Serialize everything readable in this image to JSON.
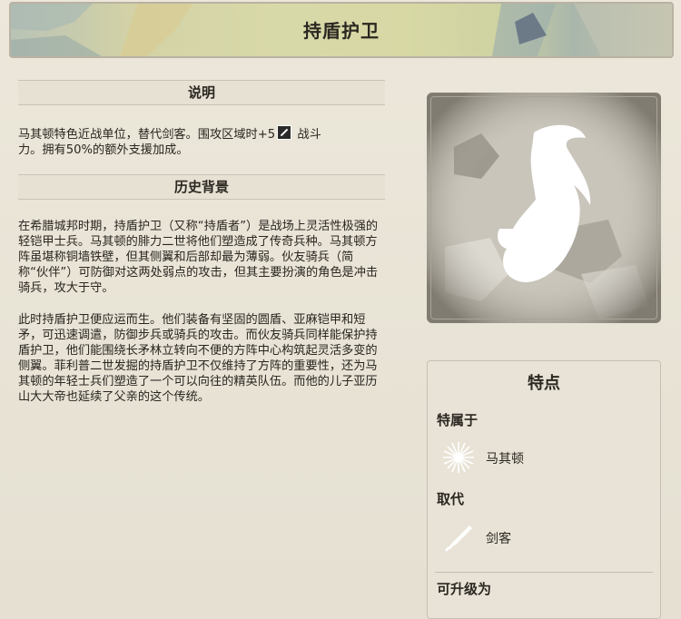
{
  "title": "持盾护卫",
  "description": {
    "heading": "说明",
    "line1_a": "马其顿特色近战单位，替代剑客。围攻区域时+5",
    "line1_b": "战斗",
    "line2": "力。拥有50%的额外支援加成。",
    "strength_icon": "sword-strength-icon"
  },
  "history": {
    "heading": "历史背景",
    "para1": "在希腊城邦时期，持盾护卫（又称“持盾者”）是战场上灵活性极强的轻铠甲士兵。马其顿的腓力二世将他们塑造成了传奇兵种。马其顿方阵虽堪称铜墙铁壁，但其侧翼和后部却最为薄弱。伙友骑兵（简称“伙伴”）可防御对这两处弱点的攻击，但其主要扮演的角色是冲击骑兵，攻大于守。",
    "para2": "此时持盾护卫便应运而生。他们装备有坚固的圆盾、亚麻铠甲和短矛，可迅速调遣，防御步兵或骑兵的攻击。而伙友骑兵同样能保护持盾护卫，他们能围绕长矛林立转向不便的方阵中心构筑起灵活多变的侧翼。菲利普二世发掘的持盾护卫不仅维持了方阵的重要性，还为马其顿的年轻士兵们塑造了一个可以向往的精英队伍。而他的儿子亚历山大大帝也延续了父亲的这个传统。"
  },
  "traits": {
    "title": "特点",
    "exclusive_label": "特属于",
    "exclusive_value": "马其顿",
    "exclusive_icon": "macedon-sun-icon",
    "replaces_label": "取代",
    "replaces_value": "剑客",
    "replaces_icon": "swordsman-icon",
    "upgrade_label": "可升级为"
  },
  "portrait_icon": "hypaspist-unit-icon",
  "colors": {
    "background": "#e9e4d6",
    "text": "#2b2721",
    "icon_white": "#ffffff"
  }
}
